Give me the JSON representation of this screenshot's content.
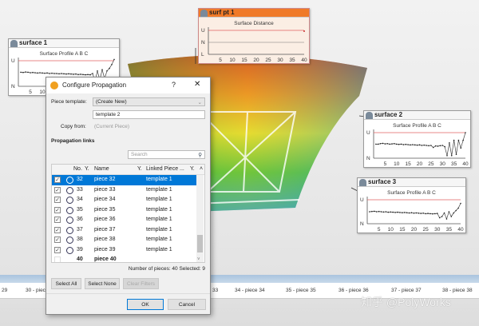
{
  "charts": [
    {
      "title": "surf pt 1",
      "subtitle": "Surface Distance",
      "ylabels": [
        "U",
        "N",
        "L"
      ],
      "xticks": [
        "5",
        "10",
        "15",
        "20",
        "25",
        "30",
        "35",
        "40"
      ]
    },
    {
      "title": "surface 1",
      "subtitle": "Surface Profile A B C",
      "ylabels": [
        "U",
        "N"
      ],
      "xticks": [
        "5",
        "10"
      ]
    },
    {
      "title": "surface 2",
      "subtitle": "Surface Profile A B C",
      "ylabels": [
        "U",
        "N"
      ],
      "xticks": [
        "5",
        "10",
        "15",
        "20",
        "25",
        "30",
        "35",
        "40"
      ]
    },
    {
      "title": "surface 3",
      "subtitle": "Surface Profile A B C",
      "ylabels": [
        "U",
        "N"
      ],
      "xticks": [
        "5",
        "10",
        "15",
        "20",
        "25",
        "30",
        "35",
        "40"
      ]
    }
  ],
  "chart_data": [
    {
      "type": "line",
      "title": "Surface Distance",
      "xlim": [
        0,
        40
      ],
      "y": "U/N/L bands",
      "series": [
        {
          "name": "surf pt 1",
          "points": [
            [
              40,
              0.95
            ]
          ]
        }
      ]
    },
    {
      "type": "line",
      "title": "Surface Profile A B C",
      "xlim": [
        0,
        40
      ],
      "ylim": [
        0,
        1
      ],
      "series": [
        {
          "name": "surface 1",
          "values": [
            0.55,
            0.54,
            0.56,
            0.55,
            0.53,
            0.54,
            0.53,
            0.52,
            0.53,
            0.52,
            0.51,
            0.52,
            0.5,
            0.51,
            0.5,
            0.5,
            0.49,
            0.5,
            0.49,
            0.48,
            0.49,
            0.48,
            0.47,
            0.48,
            0.46,
            0.47,
            0.46,
            0.45,
            0.46,
            0.45,
            0.5,
            0.2,
            0.6,
            0.25,
            0.65,
            0.3,
            0.6,
            0.7,
            0.85,
            1.05
          ]
        }
      ]
    },
    {
      "type": "line",
      "title": "Surface Profile A B C",
      "xlim": [
        0,
        40
      ],
      "ylim": [
        0,
        1
      ],
      "series": [
        {
          "name": "surface 2",
          "values": [
            0.55,
            0.55,
            0.57,
            0.58,
            0.56,
            0.57,
            0.55,
            0.56,
            0.57,
            0.55,
            0.54,
            0.55,
            0.53,
            0.54,
            0.53,
            0.52,
            0.53,
            0.52,
            0.51,
            0.52,
            0.5,
            0.51,
            0.5,
            0.49,
            0.5,
            0.42,
            0.48,
            0.47,
            0.49,
            0.5,
            0.45,
            0.1,
            0.6,
            0.1,
            0.7,
            0.15,
            0.7,
            0.4,
            0.7,
            1.0
          ]
        }
      ]
    },
    {
      "type": "line",
      "title": "Surface Profile A B C",
      "xlim": [
        0,
        40
      ],
      "ylim": [
        0,
        1
      ],
      "series": [
        {
          "name": "surface 3",
          "values": [
            0.5,
            0.51,
            0.52,
            0.5,
            0.51,
            0.5,
            0.49,
            0.5,
            0.48,
            0.49,
            0.48,
            0.47,
            0.48,
            0.47,
            0.46,
            0.47,
            0.46,
            0.45,
            0.46,
            0.44,
            0.45,
            0.44,
            0.43,
            0.44,
            0.42,
            0.43,
            0.42,
            0.41,
            0.42,
            0.43,
            0.25,
            0.3,
            0.45,
            0.2,
            0.5,
            0.3,
            0.45,
            0.55,
            0.65,
            0.85
          ]
        }
      ]
    }
  ],
  "dialog": {
    "title": "Configure Propagation",
    "help": "?",
    "close": "✕",
    "piece_template_label": "Piece template:",
    "piece_template_value": "(Create New)",
    "template_name": "template 2",
    "copy_from_label": "Copy from:",
    "copy_from_value": "(Current Piece)",
    "section": "Propagation links",
    "search_placeholder": "Search",
    "columns": [
      "No.",
      "Name",
      "Linked Piece ..."
    ],
    "rows": [
      {
        "no": "32",
        "name": "piece 32",
        "linked": "template 1",
        "checked": true,
        "selected": true
      },
      {
        "no": "33",
        "name": "piece 33",
        "linked": "template 1",
        "checked": true
      },
      {
        "no": "34",
        "name": "piece 34",
        "linked": "template 1",
        "checked": true
      },
      {
        "no": "35",
        "name": "piece 35",
        "linked": "template 1",
        "checked": true
      },
      {
        "no": "36",
        "name": "piece 36",
        "linked": "template 1",
        "checked": true
      },
      {
        "no": "37",
        "name": "piece 37",
        "linked": "template 1",
        "checked": true
      },
      {
        "no": "38",
        "name": "piece 38",
        "linked": "template 1",
        "checked": true
      },
      {
        "no": "39",
        "name": "piece 39",
        "linked": "template 1",
        "checked": true
      },
      {
        "no": "40",
        "name": "piece 40",
        "linked": "",
        "checked": false
      }
    ],
    "status": "Number of pieces: 40 Selected: 9",
    "select_all": "Select All",
    "select_none": "Select None",
    "clear_filters": "Clear Filters",
    "ok": "OK",
    "cancel": "Cancel"
  },
  "timeline": [
    "29",
    "30 - piece 30",
    "33",
    "34 - piece 34",
    "35 - piece 35",
    "36 - piece 36",
    "37 - piece 37",
    "38 - piece 38"
  ],
  "watermark": "知乎 @PolyWorks"
}
